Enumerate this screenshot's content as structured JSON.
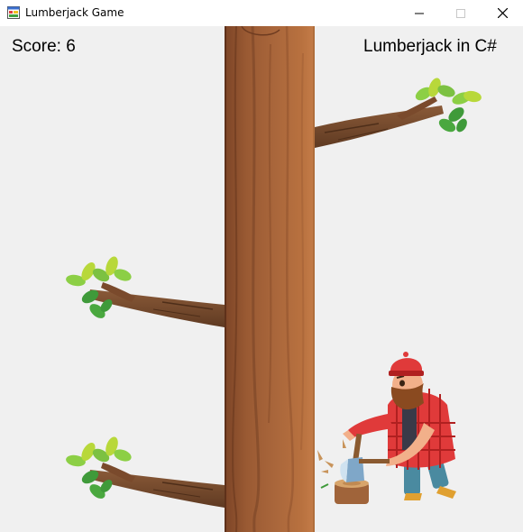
{
  "window": {
    "title": "Lumberjack Game",
    "app_icon": "winforms-app-icon",
    "controls": [
      "minimize-icon",
      "maximize-icon",
      "close-icon"
    ]
  },
  "hud": {
    "score_text": "Score: 6",
    "game_label": "Lumberjack in C#"
  },
  "scene": {
    "background_color": "#f0f0f0",
    "trunk_colors": [
      "#8b5030",
      "#a8643a",
      "#c27a48"
    ],
    "branch_color": "#7a4a2c",
    "leaf_colors": [
      "#7cc142",
      "#b8d83a",
      "#3f9a3a"
    ],
    "branches": [
      {
        "side": "right",
        "leaves": true
      },
      {
        "side": "left",
        "leaves": true
      },
      {
        "side": "left",
        "leaves": true
      }
    ],
    "player": {
      "character": "lumberjack",
      "side": "right",
      "action": "chopping"
    }
  }
}
